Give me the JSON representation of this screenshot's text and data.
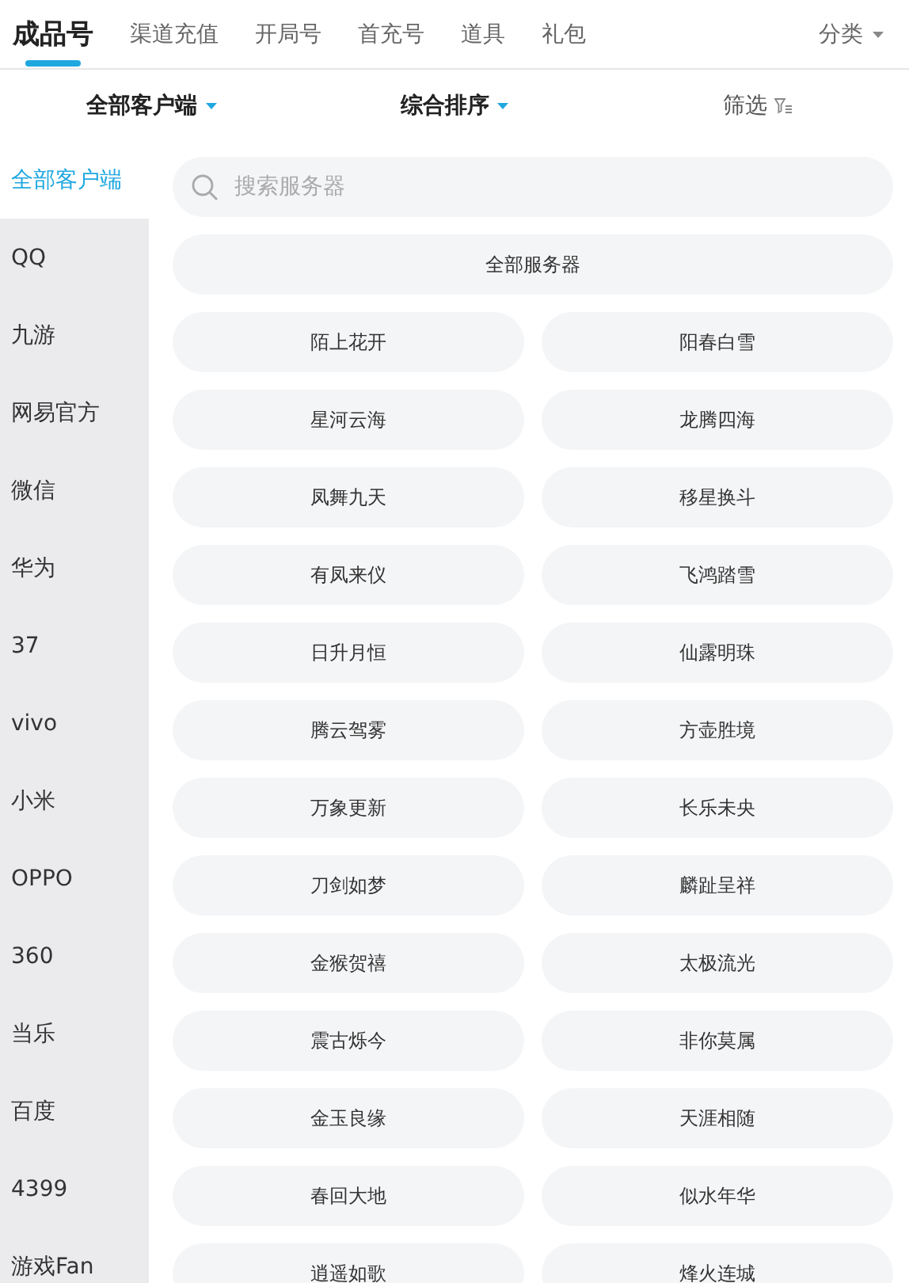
{
  "tabs": [
    {
      "label": "成品号",
      "selected": true
    },
    {
      "label": "渠道充值",
      "selected": false
    },
    {
      "label": "开局号",
      "selected": false
    },
    {
      "label": "首充号",
      "selected": false
    },
    {
      "label": "道具",
      "selected": false
    },
    {
      "label": "礼包",
      "selected": false
    }
  ],
  "category_menu": {
    "label": "分类"
  },
  "filters": [
    {
      "kind": "dropdown",
      "label": "全部客户端"
    },
    {
      "kind": "dropdown",
      "label": "综合排序"
    },
    {
      "kind": "filter",
      "label": "筛选"
    }
  ],
  "sidebar": {
    "items": [
      {
        "label": "全部客户端",
        "selected": true
      },
      {
        "label": "QQ",
        "selected": false
      },
      {
        "label": "九游",
        "selected": false
      },
      {
        "label": "网易官方",
        "selected": false
      },
      {
        "label": "微信",
        "selected": false
      },
      {
        "label": "华为",
        "selected": false
      },
      {
        "label": "37",
        "selected": false
      },
      {
        "label": "vivo",
        "selected": false
      },
      {
        "label": "小米",
        "selected": false
      },
      {
        "label": "OPPO",
        "selected": false
      },
      {
        "label": "360",
        "selected": false
      },
      {
        "label": "当乐",
        "selected": false
      },
      {
        "label": "百度",
        "selected": false
      },
      {
        "label": "4399",
        "selected": false
      },
      {
        "label": "游戏Fan",
        "selected": false
      }
    ]
  },
  "search": {
    "placeholder": "搜索服务器"
  },
  "all_servers": "全部服务器",
  "servers": [
    "陌上花开",
    "阳春白雪",
    "星河云海",
    "龙腾四海",
    "凤舞九天",
    "移星换斗",
    "有凤来仪",
    "飞鸿踏雪",
    "日升月恒",
    "仙露明珠",
    "腾云驾雾",
    "方壶胜境",
    "万象更新",
    "长乐未央",
    "刀剑如梦",
    "麟趾呈祥",
    "金猴贺禧",
    "太极流光",
    "震古烁今",
    "非你莫属",
    "金玉良缘",
    "天涯相随",
    "春回大地",
    "似水年华",
    "逍遥如歌",
    "烽火连城"
  ]
}
